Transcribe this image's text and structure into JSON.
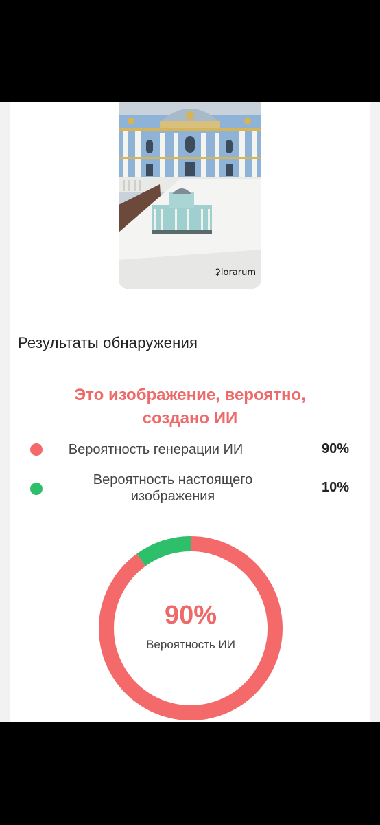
{
  "photo": {
    "watermark": "lorarum",
    "watermark_icon": "florarum-logo-icon"
  },
  "results": {
    "title": "Результаты обнаружения",
    "verdict_line1": "Это изображение, вероятно,",
    "verdict_line2": "создано ИИ",
    "ai": {
      "label": "Вероятность генерации ИИ",
      "value": "90%",
      "color": "#f46a6a"
    },
    "real": {
      "label_line1": "Вероятность настоящего",
      "label_line2": "изображения",
      "value": "10%",
      "color": "#2ebf6a"
    }
  },
  "chart_data": {
    "type": "pie",
    "categories": [
      "Вероятность генерации ИИ",
      "Вероятность настоящего изображения"
    ],
    "values": [
      90,
      10
    ],
    "colors": [
      "#f46a6a",
      "#2ebf6a"
    ],
    "center_value": "90%",
    "center_label": "Вероятность ИИ"
  }
}
